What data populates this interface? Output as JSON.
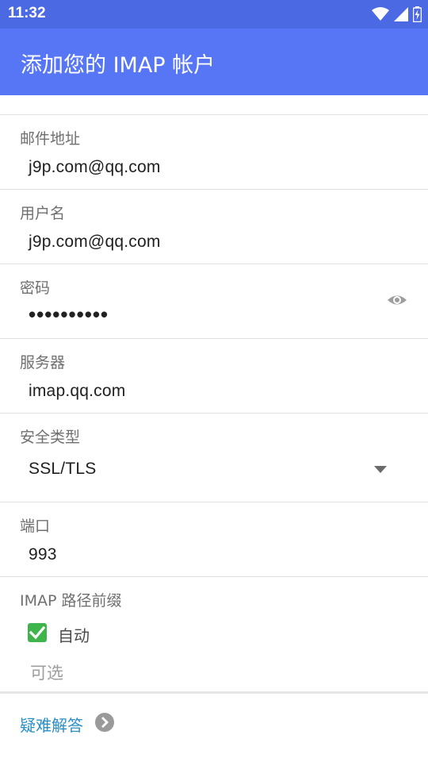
{
  "status_bar": {
    "time": "11:32",
    "icons": [
      "wifi-icon",
      "cell-signal-icon",
      "battery-charging-icon"
    ]
  },
  "app_bar": {
    "title": "添加您的 IMAP 帐户",
    "color": "#5676f5"
  },
  "form": {
    "email": {
      "label": "邮件地址",
      "value": "j9p.com@qq.com"
    },
    "username": {
      "label": "用户名",
      "value": "j9p.com@qq.com"
    },
    "password": {
      "label": "密码",
      "value": "••••••••••",
      "toggle_icon": "eye-icon"
    },
    "server": {
      "label": "服务器",
      "value": "imap.qq.com"
    },
    "security": {
      "label": "安全类型",
      "value": "SSL/TLS"
    },
    "port": {
      "label": "端口",
      "value": "993"
    },
    "imap_prefix": {
      "label": "IMAP 路径前缀",
      "auto_checkbox": {
        "label": "自动",
        "checked": true,
        "color": "#3db54a"
      },
      "placeholder": "可选"
    }
  },
  "help": {
    "link_label": "疑难解答",
    "link_color": "#2a8fc7"
  }
}
